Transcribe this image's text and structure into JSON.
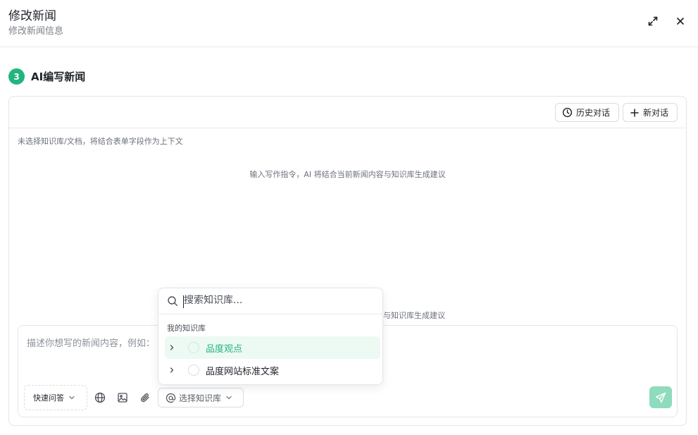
{
  "header": {
    "title": "修改新闻",
    "subtitle": "修改新闻信息"
  },
  "step": {
    "number": "3",
    "title": "AI编写新闻"
  },
  "toolbar": {
    "history_label": "历史对话",
    "new_label": "新对话"
  },
  "context_note": "未选择知识库/文档，将结合表单字段作为上下文",
  "hint": "输入写作指令，AI 将结合当前新闻内容与知识库生成建议",
  "hint_partial": "与知识库生成建议",
  "composer": {
    "placeholder": "描述你想写的新闻内容，例如：",
    "quick_label": "快速问答",
    "kb_select_label": "选择知识库"
  },
  "kb_dropdown": {
    "search_placeholder": "搜索知识库...",
    "group_label": "我的知识库",
    "items": [
      {
        "label": "品度观点",
        "active": true
      },
      {
        "label": "品度网站标准文案",
        "active": false
      }
    ]
  },
  "colors": {
    "accent": "#22b57f",
    "accent_light": "#edf9f3",
    "send_disabled": "#8fdbbd"
  },
  "icons": {
    "expand": "expand-icon",
    "close": "close-icon",
    "history": "clock-icon",
    "new": "plus-icon",
    "globe": "globe-icon",
    "image": "image-icon",
    "attach": "paperclip-icon",
    "at": "at-icon",
    "send": "send-icon",
    "search": "search-icon"
  }
}
